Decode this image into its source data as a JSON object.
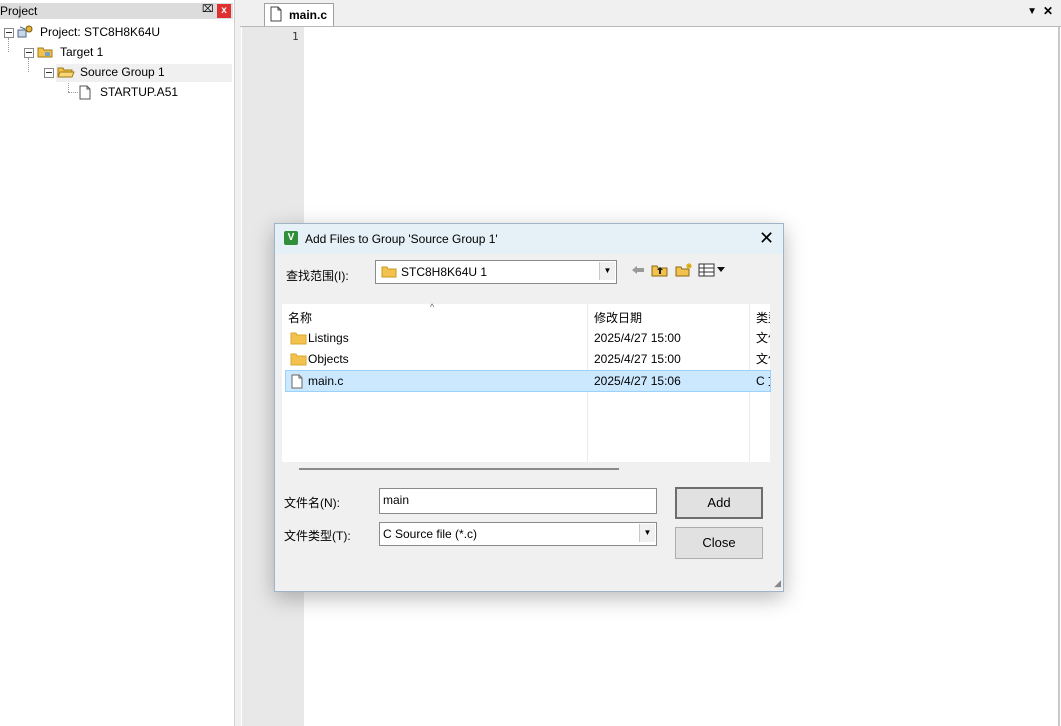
{
  "project_panel": {
    "title": "Project",
    "pin_glyph": "⌧",
    "close_glyph": "x",
    "tree": {
      "project": "Project: STC8H8K64U",
      "target": "Target 1",
      "group": "Source Group 1",
      "file": "STARTUP.A51"
    }
  },
  "editor": {
    "tab_label": "main.c",
    "line_number": "1",
    "dropdown_glyph": "▼",
    "close_glyph": "✕"
  },
  "dialog": {
    "app_icon_text": "V",
    "title": "Add Files to Group 'Source Group 1'",
    "close_glyph": "✕",
    "look_in_label": "查找范围(I):",
    "look_in_value": "STC8H8K64U 1",
    "columns": {
      "name": "名称",
      "date": "修改日期",
      "type": "类型"
    },
    "files": [
      {
        "name": "Listings",
        "date": "2025/4/27 15:00",
        "type": "文件夹",
        "kind": "folder",
        "selected": false
      },
      {
        "name": "Objects",
        "date": "2025/4/27 15:00",
        "type": "文件夹",
        "kind": "folder",
        "selected": false
      },
      {
        "name": "main.c",
        "date": "2025/4/27 15:06",
        "type": "C 文件",
        "kind": "file",
        "selected": true
      }
    ],
    "filename_label": "文件名(N):",
    "filename_value": "main",
    "filetype_label": "文件类型(T):",
    "filetype_value": "C Source file (*.c)",
    "add_button": "Add",
    "close_button": "Close",
    "icons": [
      "back-arrow-icon",
      "up-folder-icon",
      "new-folder-icon",
      "view-menu-icon"
    ]
  },
  "colors": {
    "selection": "#cce8ff",
    "folder": "#f2c14e",
    "dialog_bg": "#f0f0f0"
  }
}
